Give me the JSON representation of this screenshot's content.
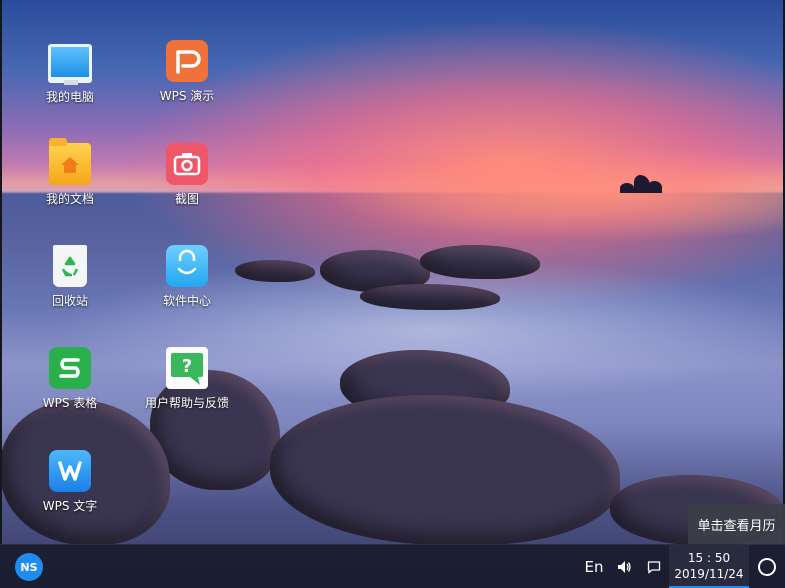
{
  "desktop": {
    "icons": [
      {
        "label": "我的电脑",
        "icon": "computer-icon"
      },
      {
        "label": "WPS 演示",
        "icon": "wps-presentation-icon"
      },
      {
        "label": "我的文档",
        "icon": "documents-folder-icon"
      },
      {
        "label": "截图",
        "icon": "screenshot-camera-icon"
      },
      {
        "label": "回收站",
        "icon": "recycle-bin-icon"
      },
      {
        "label": "软件中心",
        "icon": "software-center-icon"
      },
      {
        "label": "WPS 表格",
        "icon": "wps-spreadsheet-icon"
      },
      {
        "label": "用户帮助与反馈",
        "icon": "help-feedback-icon"
      },
      {
        "label": "WPS 文字",
        "icon": "wps-writer-icon"
      }
    ]
  },
  "taskbar": {
    "start_logo": "NS",
    "language": "En",
    "clock_time": "15 : 50",
    "clock_date": "2019/11/24"
  },
  "tooltip": {
    "text": "单击查看月历"
  },
  "colors": {
    "accent": "#1f8cf0",
    "taskbar_bg": "#191b2d"
  }
}
